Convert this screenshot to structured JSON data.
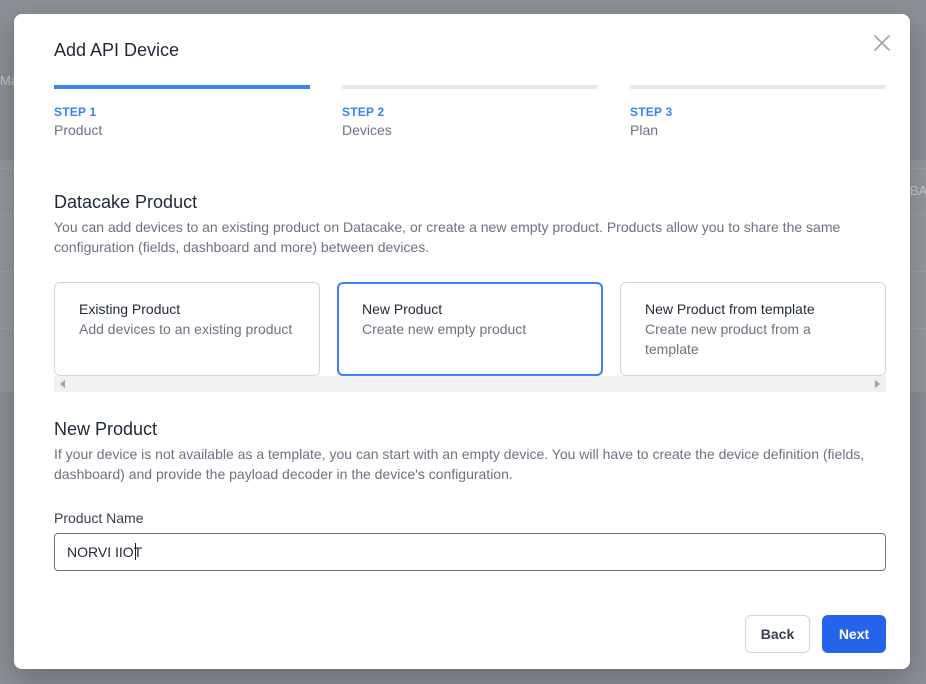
{
  "background": {
    "fragment_left": "Ma",
    "fragment_right": "BA"
  },
  "modal": {
    "title": "Add API Device"
  },
  "steps": [
    {
      "number": "STEP 1",
      "label": "Product",
      "active": true
    },
    {
      "number": "STEP 2",
      "label": "Devices",
      "active": false
    },
    {
      "number": "STEP 3",
      "label": "Plan",
      "active": false
    }
  ],
  "product_section": {
    "title": "Datacake Product",
    "description": "You can add devices to an existing product on Datacake, or create a new empty product. Products allow you to share the same configuration (fields, dashboard and more) between devices."
  },
  "options": [
    {
      "title": "Existing Product",
      "description": "Add devices to an existing product",
      "selected": false
    },
    {
      "title": "New Product",
      "description": "Create new empty product",
      "selected": true
    },
    {
      "title": "New Product from template",
      "description": "Create new product from a template",
      "selected": false
    }
  ],
  "new_product_section": {
    "title": "New Product",
    "description": "If your device is not available as a template, you can start with an empty device. You will have to create the device definition (fields, dashboard) and provide the payload decoder in the device's configuration."
  },
  "product_name": {
    "label": "Product Name",
    "value": "NORVI IIOT"
  },
  "buttons": {
    "back": "Back",
    "next": "Next"
  },
  "colors": {
    "accent": "#3b82f6",
    "primary_button": "#2563eb",
    "overlay": "#8c9097"
  },
  "icons": {
    "close": "close-icon"
  }
}
